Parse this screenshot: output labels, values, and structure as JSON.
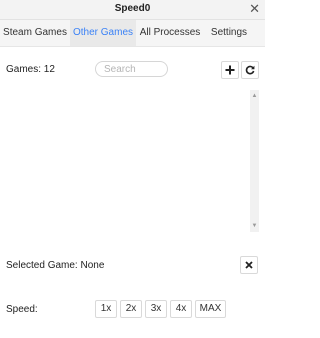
{
  "window": {
    "title": "Speed0",
    "close_symbol": "✕"
  },
  "tabs": [
    {
      "label": "Steam Games",
      "active": false
    },
    {
      "label": "Other Games",
      "active": true
    },
    {
      "label": "All Processes",
      "active": false
    },
    {
      "label": "Settings",
      "active": false
    }
  ],
  "games": {
    "count_label": "Games: 12"
  },
  "search": {
    "placeholder": "Search",
    "value": ""
  },
  "toolbar": {
    "add_icon": "plus-icon",
    "refresh_icon": "refresh-icon"
  },
  "game_list": {
    "items": []
  },
  "selection": {
    "label": "Selected Game: None",
    "clear_icon": "close-icon"
  },
  "speed": {
    "label": "Speed:",
    "options": [
      "1x",
      "2x",
      "3x",
      "4x",
      "MAX"
    ]
  },
  "colors": {
    "accent": "#3b82f6",
    "tab_active_bg": "#e9e9e9"
  }
}
